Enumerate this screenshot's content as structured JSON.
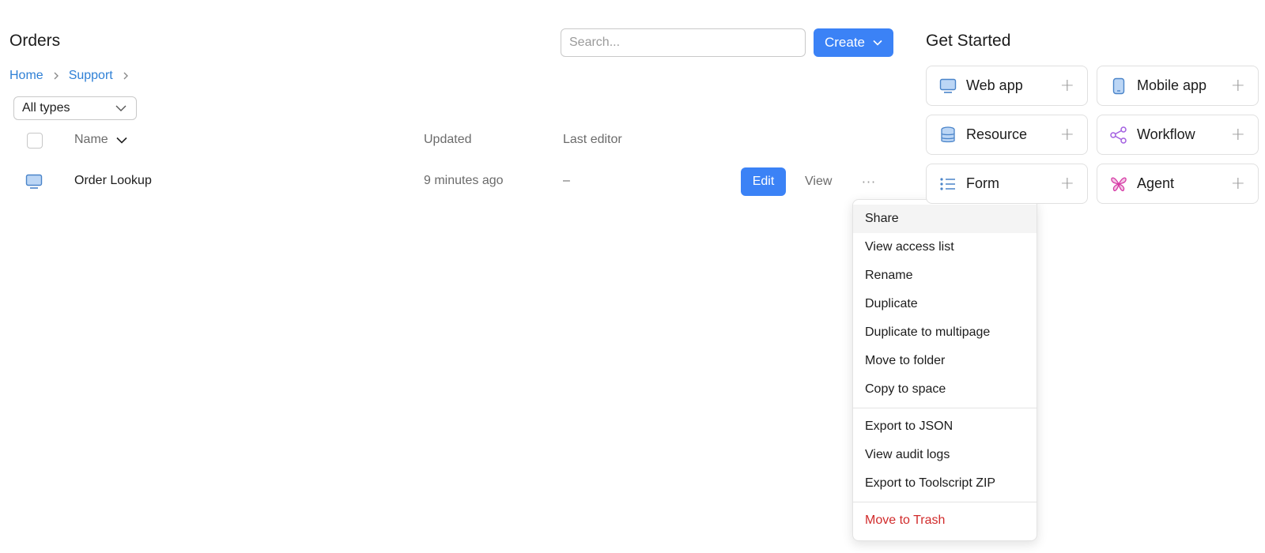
{
  "header": {
    "title": "Orders",
    "search_placeholder": "Search...",
    "create_label": "Create"
  },
  "breadcrumb": [
    "Home",
    "Support"
  ],
  "filter": {
    "selected": "All types"
  },
  "table": {
    "columns": {
      "name": "Name",
      "updated": "Updated",
      "last_editor": "Last editor"
    },
    "rows": [
      {
        "name": "Order Lookup",
        "updated": "9 minutes ago",
        "last_editor": "–",
        "edit_label": "Edit",
        "view_label": "View",
        "more_label": "···"
      }
    ]
  },
  "menu": {
    "items": [
      "Share",
      "View access list",
      "Rename",
      "Duplicate",
      "Duplicate to multipage",
      "Move to folder",
      "Copy to space",
      "Export to JSON",
      "View audit logs",
      "Export to Toolscript ZIP",
      "Move to Trash"
    ]
  },
  "get_started": {
    "title": "Get Started",
    "cards": [
      {
        "label": "Web app",
        "icon": "monitor-icon"
      },
      {
        "label": "Mobile app",
        "icon": "phone-icon"
      },
      {
        "label": "Resource",
        "icon": "database-icon"
      },
      {
        "label": "Workflow",
        "icon": "share-nodes-icon"
      },
      {
        "label": "Form",
        "icon": "list-icon"
      },
      {
        "label": "Agent",
        "icon": "agent-icon"
      }
    ]
  },
  "colors": {
    "primary": "#3b82f6",
    "link": "#2f80d6",
    "danger": "#d12b2b",
    "workflow_purple": "#a25fe0",
    "agent_pink": "#d63aa5"
  }
}
